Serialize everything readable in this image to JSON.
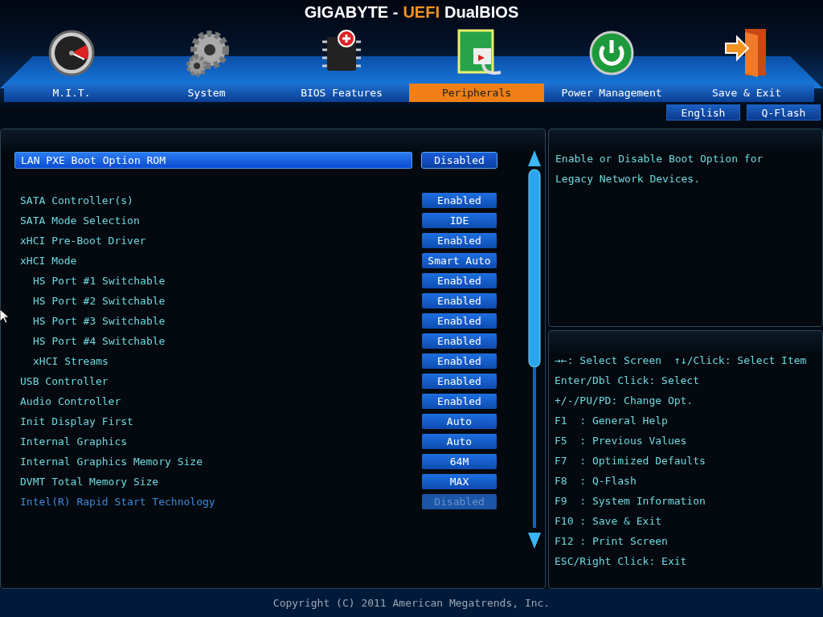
{
  "header": {
    "title_parts": [
      {
        "text": "GIGABYTE -",
        "accent": false
      },
      {
        "text": "UEFI",
        "accent": true
      },
      {
        "text": "DualBIOS",
        "accent": false
      }
    ]
  },
  "tabs": [
    {
      "label": "M.I.T.",
      "selected": false
    },
    {
      "label": "System",
      "selected": false
    },
    {
      "label": "BIOS Features",
      "selected": false
    },
    {
      "label": "Peripherals",
      "selected": true
    },
    {
      "label": "Power Management",
      "selected": false
    },
    {
      "label": "Save & Exit",
      "selected": false
    }
  ],
  "top_buttons": [
    "English",
    "Q-Flash"
  ],
  "settings": {
    "sections": [
      {
        "items": [
          {
            "label": "LAN PXE Boot Option ROM",
            "value": "Disabled",
            "selected": true,
            "disabled": false
          }
        ]
      },
      {
        "items": [
          {
            "label": "SATA Controller(s)",
            "value": "Enabled",
            "selected": false,
            "disabled": false
          },
          {
            "label": "SATA Mode Selection",
            "value": "IDE",
            "selected": false,
            "disabled": false
          },
          {
            "label": "xHCI Pre-Boot Driver",
            "value": "Enabled",
            "selected": false,
            "disabled": false
          },
          {
            "label": "xHCI Mode",
            "value": "Smart Auto",
            "selected": false,
            "disabled": false,
            "children": [
              {
                "label": "HS Port #1 Switchable",
                "value": "Enabled",
                "selected": false,
                "disabled": false
              },
              {
                "label": "HS Port #2 Switchable",
                "value": "Enabled",
                "selected": false,
                "disabled": false
              },
              {
                "label": "HS Port #3 Switchable",
                "value": "Enabled",
                "selected": false,
                "disabled": false
              },
              {
                "label": "HS Port #4 Switchable",
                "value": "Enabled",
                "selected": false,
                "disabled": false
              },
              {
                "label": "xHCI Streams",
                "value": "Enabled",
                "selected": false,
                "disabled": false
              }
            ]
          },
          {
            "label": "USB Controller",
            "value": "Enabled",
            "selected": false,
            "disabled": false
          },
          {
            "label": "Audio Controller",
            "value": "Enabled",
            "selected": false,
            "disabled": false
          },
          {
            "label": "Init Display First",
            "value": "Auto",
            "selected": false,
            "disabled": false
          },
          {
            "label": "Internal Graphics",
            "value": "Auto",
            "selected": false,
            "disabled": false
          },
          {
            "label": "Internal Graphics Memory Size",
            "value": "64M",
            "selected": false,
            "disabled": false
          },
          {
            "label": "DVMT Total Memory Size",
            "value": "MAX",
            "selected": false,
            "disabled": false
          },
          {
            "label": "Intel(R) Rapid Start Technology",
            "value": "Disabled",
            "selected": false,
            "disabled": true
          }
        ]
      }
    ]
  },
  "help": {
    "text": "Enable or Disable Boot Option for Legacy Network Devices."
  },
  "key_legend": {
    "lines": [
      [
        "→←: Select Screen",
        "↑↓/Click: Select Item"
      ],
      [
        "Enter/Dbl Click: Select"
      ],
      [
        "+/-/PU/PD: Change Opt."
      ],
      [
        "F1  : General Help"
      ],
      [
        "F5  : Previous Values"
      ],
      [
        "F7  : Optimized Defaults"
      ],
      [
        "F8  : Q-Flash"
      ],
      [
        "F9  : System Information"
      ],
      [
        "F10 : Save & Exit"
      ],
      [
        "F12 : Print Screen"
      ],
      [
        "ESC/Right Click: Exit"
      ]
    ]
  },
  "footer": {
    "copyright": "Copyright (C) 2011 American Megatrends, Inc."
  }
}
